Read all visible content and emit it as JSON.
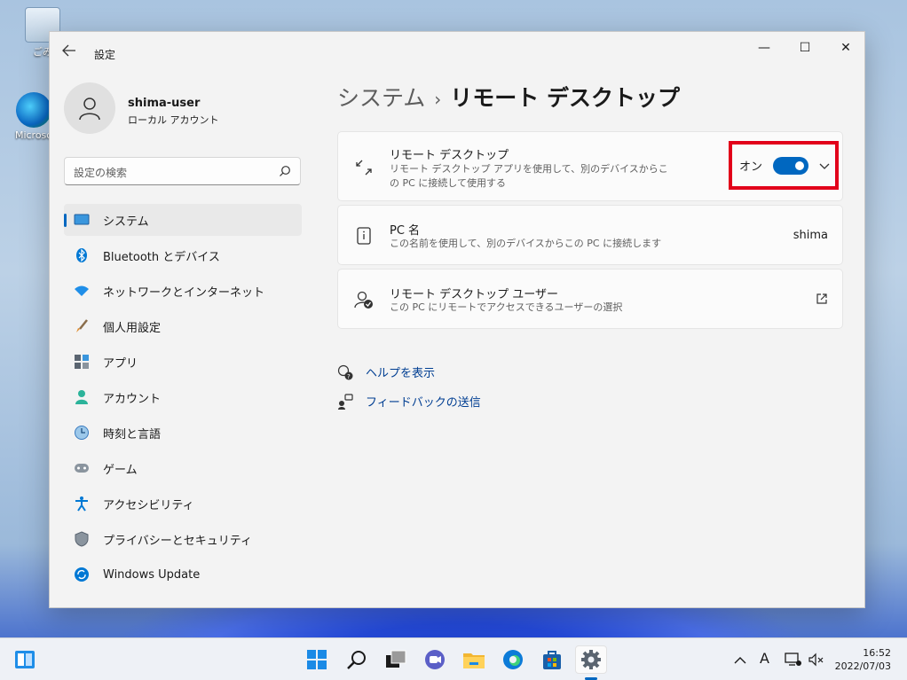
{
  "desktop": {
    "icons": [
      {
        "label": "ごみ"
      },
      {
        "label": "Microso"
      }
    ]
  },
  "window": {
    "app_title": "設定",
    "controls": {
      "minimize": "—",
      "maximize": "☐",
      "close": "✕"
    }
  },
  "profile": {
    "name": "shima-user",
    "account_type": "ローカル アカウント"
  },
  "search": {
    "placeholder": "設定の検索"
  },
  "sidebar": {
    "items": [
      {
        "label": "システム",
        "icon": "system-icon",
        "active": true
      },
      {
        "label": "Bluetooth とデバイス",
        "icon": "bluetooth-icon"
      },
      {
        "label": "ネットワークとインターネット",
        "icon": "wifi-icon"
      },
      {
        "label": "個人用設定",
        "icon": "brush-icon"
      },
      {
        "label": "アプリ",
        "icon": "apps-icon"
      },
      {
        "label": "アカウント",
        "icon": "account-icon"
      },
      {
        "label": "時刻と言語",
        "icon": "time-language-icon"
      },
      {
        "label": "ゲーム",
        "icon": "gamepad-icon"
      },
      {
        "label": "アクセシビリティ",
        "icon": "accessibility-icon"
      },
      {
        "label": "プライバシーとセキュリティ",
        "icon": "shield-icon"
      },
      {
        "label": "Windows Update",
        "icon": "update-icon"
      }
    ]
  },
  "breadcrumb": {
    "parent": "システム",
    "separator": "›",
    "current": "リモート デスクトップ"
  },
  "cards": {
    "remote_desktop": {
      "title": "リモート デスクトップ",
      "description": "リモート デスクトップ アプリを使用して、別のデバイスからこの PC に接続して使用する",
      "toggle_label": "オン",
      "toggle_on": true
    },
    "pc_name": {
      "title": "PC 名",
      "description": "この名前を使用して、別のデバイスからこの PC に接続します",
      "value": "shima"
    },
    "remote_users": {
      "title": "リモート デスクトップ ユーザー",
      "description": "この PC にリモートでアクセスできるユーザーの選択"
    }
  },
  "links": {
    "help": "ヘルプを表示",
    "feedback": "フィードバックの送信"
  },
  "taskbar": {
    "tray_ime": "A",
    "time": "16:52",
    "date": "2022/07/03"
  },
  "colors": {
    "accent": "#0067c0",
    "highlight_box": "#e2001a"
  }
}
